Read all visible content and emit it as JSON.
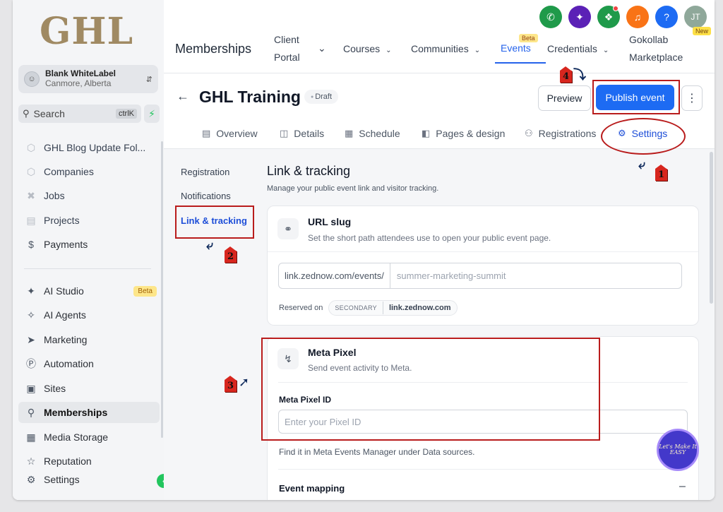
{
  "sidebar": {
    "logo": "GHL",
    "account": {
      "name": "Blank WhiteLabel",
      "location": "Canmore, Alberta"
    },
    "search": {
      "label": "Search",
      "shortcut": "ctrlK"
    },
    "items": [
      {
        "label": "GHL Blog Update Fol..."
      },
      {
        "label": "Companies"
      },
      {
        "label": "Jobs"
      },
      {
        "label": "Projects"
      },
      {
        "label": "Payments"
      },
      {
        "label": "AI Studio",
        "badge": "Beta"
      },
      {
        "label": "AI Agents"
      },
      {
        "label": "Marketing"
      },
      {
        "label": "Automation"
      },
      {
        "label": "Sites"
      },
      {
        "label": "Memberships"
      },
      {
        "label": "Media Storage"
      },
      {
        "label": "Reputation"
      },
      {
        "label": "Settings"
      }
    ]
  },
  "topbar": {
    "avatar_initials": "JT",
    "new_badge": "New",
    "app_title": "Memberships",
    "nav": [
      {
        "label": "Client\nPortal"
      },
      {
        "label": "Courses"
      },
      {
        "label": "Communities"
      },
      {
        "label": "Events",
        "badge": "Beta"
      },
      {
        "label": "Credentials"
      },
      {
        "label": "Gokollab\nMarketplace"
      }
    ],
    "colors": {
      "phone": "#1f9a4a",
      "ai": "#5b21b6",
      "announce": "#1f9a4a",
      "notify": "#f97316",
      "help": "#1d6bf3",
      "avatar": "#8fa89a"
    }
  },
  "event": {
    "title": "GHL Training",
    "status": "Draft",
    "preview_label": "Preview",
    "publish_label": "Publish event",
    "tabs": [
      {
        "label": "Overview"
      },
      {
        "label": "Details"
      },
      {
        "label": "Schedule"
      },
      {
        "label": "Pages & design"
      },
      {
        "label": "Registrations"
      },
      {
        "label": "Settings"
      }
    ]
  },
  "settings_nav": [
    {
      "label": "Registration"
    },
    {
      "label": "Notifications"
    },
    {
      "label": "Link & tracking"
    }
  ],
  "link_tracking": {
    "title": "Link & tracking",
    "subtitle": "Manage your public event link and visitor tracking.",
    "url_slug": {
      "title": "URL slug",
      "subtitle": "Set the short path attendees use to open your public event page.",
      "prefix": "link.zednow.com/events/",
      "placeholder": "summer-marketing-summit",
      "reserved_label": "Reserved on",
      "domain_tag": "SECONDARY",
      "domain": "link.zednow.com"
    },
    "meta_pixel": {
      "title": "Meta Pixel",
      "subtitle": "Send event activity to Meta.",
      "field_label": "Meta Pixel ID",
      "placeholder": "Enter your Pixel ID",
      "help": "Find it in Meta Events Manager under Data sources.",
      "mapping_label": "Event mapping",
      "mapping_toggle": "–"
    }
  },
  "annotations": {
    "steps": [
      "1",
      "2",
      "3",
      "4"
    ],
    "watermark": "Let's Make It EASY",
    "color": "#b91c1c"
  }
}
